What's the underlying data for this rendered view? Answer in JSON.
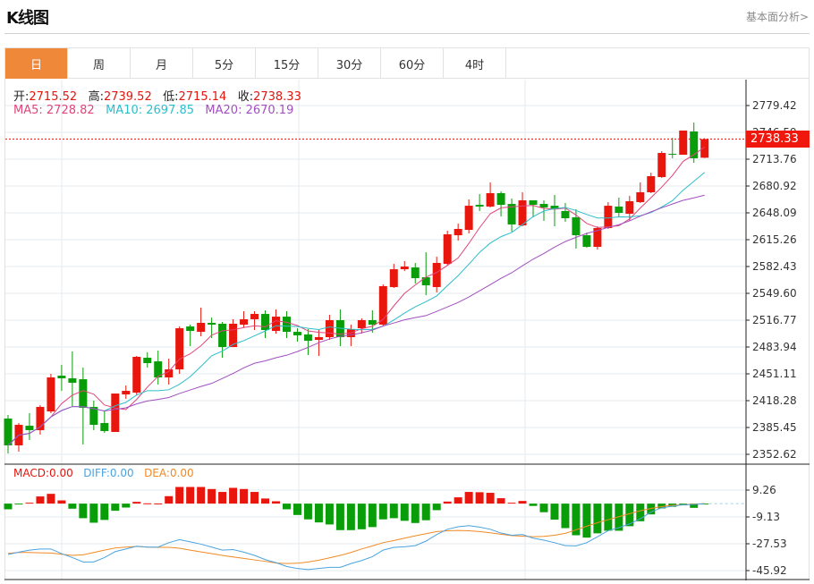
{
  "header": {
    "title": "K线图",
    "link": "基本面分析>"
  },
  "tabs": [
    {
      "label": "日",
      "active": true
    },
    {
      "label": "周"
    },
    {
      "label": "月"
    },
    {
      "label": "5分"
    },
    {
      "label": "15分"
    },
    {
      "label": "30分"
    },
    {
      "label": "60分"
    },
    {
      "label": "4时"
    }
  ],
  "ohlc_info": {
    "open_label": "开:",
    "open": "2715.52",
    "high_label": "高:",
    "high": "2739.52",
    "low_label": "低:",
    "low": "2715.14",
    "close_label": "收:",
    "close": "2738.33"
  },
  "ma_info": {
    "ma5_label": "MA5:",
    "ma5": "2728.82",
    "ma10_label": "MA10:",
    "ma10": "2697.85",
    "ma20_label": "MA20:",
    "ma20": "2670.19"
  },
  "macd_info": {
    "macd_label": "MACD:",
    "macd": "0.00",
    "diff_label": "DIFF:",
    "diff": "0.00",
    "dea_label": "DEA:",
    "dea": "0.00"
  },
  "last_price_tag": "2738.33",
  "colors": {
    "up": "#e8160c",
    "down": "#0a9d0a",
    "accent_tab": "#f0883a",
    "ma5": "#e0457b",
    "ma10": "#2dbdcb",
    "ma20": "#a24fbf",
    "diff": "#4aa3e0",
    "dea": "#f08a24"
  },
  "chart_data": [
    {
      "type": "candlestick",
      "title": "",
      "y_ticks": [
        "2779.42",
        "2746.59",
        "2713.76",
        "2680.92",
        "2648.09",
        "2615.26",
        "2582.43",
        "2549.60",
        "2516.77",
        "2483.94",
        "2451.11",
        "2418.28",
        "2385.45",
        "2352.62"
      ],
      "ylim": [
        2352.62,
        2779.42
      ],
      "grid": true,
      "last_price": 2738.33,
      "moving_averages": [
        5,
        10,
        20
      ],
      "candles": [
        [
          2396.4,
          2400.8,
          2353.7,
          2363.6
        ],
        [
          2363.6,
          2390.9,
          2355.9,
          2388.7
        ],
        [
          2387.6,
          2403.0,
          2370.1,
          2382.2
        ],
        [
          2382.2,
          2412.8,
          2376.7,
          2410.6
        ],
        [
          2405.1,
          2451.1,
          2403.0,
          2446.7
        ],
        [
          2448.9,
          2462.0,
          2430.3,
          2445.6
        ],
        [
          2445.6,
          2478.5,
          2410.6,
          2440.2
        ],
        [
          2444.5,
          2458.8,
          2364.6,
          2409.5
        ],
        [
          2410.6,
          2418.3,
          2382.2,
          2388.7
        ],
        [
          2390.9,
          2406.2,
          2378.9,
          2381.1
        ],
        [
          2380.0,
          2427.0,
          2380.0,
          2427.0
        ],
        [
          2425.9,
          2436.9,
          2420.5,
          2430.3
        ],
        [
          2428.1,
          2473.0,
          2424.8,
          2471.9
        ],
        [
          2470.8,
          2477.4,
          2458.8,
          2464.2
        ],
        [
          2466.4,
          2479.6,
          2438.0,
          2446.7
        ],
        [
          2446.7,
          2469.7,
          2438.0,
          2456.6
        ],
        [
          2456.6,
          2509.1,
          2451.1,
          2506.9
        ],
        [
          2509.1,
          2511.3,
          2485.0,
          2503.6
        ],
        [
          2502.5,
          2532.1,
          2497.1,
          2513.5
        ],
        [
          2513.5,
          2520.0,
          2494.9,
          2511.3
        ],
        [
          2512.4,
          2514.6,
          2470.8,
          2483.9
        ],
        [
          2483.9,
          2517.9,
          2483.9,
          2512.4
        ],
        [
          2511.3,
          2527.7,
          2508.0,
          2517.9
        ],
        [
          2517.9,
          2527.7,
          2504.7,
          2524.4
        ],
        [
          2524.4,
          2528.8,
          2494.9,
          2504.7
        ],
        [
          2503.6,
          2529.9,
          2500.4,
          2521.1
        ],
        [
          2521.1,
          2527.7,
          2494.9,
          2502.5
        ],
        [
          2502.5,
          2506.9,
          2490.5,
          2498.2
        ],
        [
          2499.3,
          2505.8,
          2474.1,
          2491.6
        ],
        [
          2492.7,
          2504.7,
          2473.0,
          2496.0
        ],
        [
          2496.0,
          2523.3,
          2492.7,
          2516.8
        ],
        [
          2516.8,
          2529.9,
          2485.0,
          2496.0
        ],
        [
          2496.0,
          2511.3,
          2485.0,
          2505.8
        ],
        [
          2506.9,
          2519.0,
          2500.4,
          2516.8
        ],
        [
          2516.8,
          2528.8,
          2501.4,
          2511.3
        ],
        [
          2511.3,
          2560.5,
          2509.1,
          2558.4
        ],
        [
          2557.3,
          2585.7,
          2556.2,
          2579.1
        ],
        [
          2579.1,
          2589.0,
          2577.0,
          2582.4
        ],
        [
          2581.3,
          2586.8,
          2561.6,
          2568.2
        ],
        [
          2569.3,
          2599.9,
          2547.4,
          2559.4
        ],
        [
          2557.3,
          2594.5,
          2550.7,
          2586.8
        ],
        [
          2585.7,
          2626.2,
          2583.5,
          2621.8
        ],
        [
          2620.7,
          2635.0,
          2614.2,
          2628.4
        ],
        [
          2627.3,
          2664.5,
          2622.9,
          2656.8
        ],
        [
          2657.9,
          2671.1,
          2650.3,
          2655.8
        ],
        [
          2655.8,
          2685.3,
          2654.7,
          2672.2
        ],
        [
          2672.2,
          2674.4,
          2643.7,
          2657.9
        ],
        [
          2659.0,
          2665.6,
          2625.1,
          2633.9
        ],
        [
          2632.8,
          2673.3,
          2631.7,
          2663.4
        ],
        [
          2663.4,
          2663.4,
          2642.6,
          2657.9
        ],
        [
          2659.0,
          2663.4,
          2638.2,
          2654.7
        ],
        [
          2656.8,
          2670.0,
          2631.7,
          2652.5
        ],
        [
          2650.3,
          2660.1,
          2637.2,
          2641.5
        ],
        [
          2642.6,
          2652.5,
          2604.3,
          2620.7
        ],
        [
          2620.7,
          2624.0,
          2605.4,
          2606.5
        ],
        [
          2606.5,
          2631.7,
          2603.2,
          2629.5
        ],
        [
          2629.5,
          2661.2,
          2628.4,
          2656.8
        ],
        [
          2655.8,
          2666.7,
          2643.7,
          2648.1
        ],
        [
          2647.0,
          2668.9,
          2638.2,
          2662.3
        ],
        [
          2661.2,
          2685.3,
          2660.1,
          2673.3
        ],
        [
          2673.3,
          2697.3,
          2672.2,
          2693.0
        ],
        [
          2691.9,
          2723.6,
          2690.8,
          2721.4
        ],
        [
          2720.3,
          2740.0,
          2714.9,
          2719.2
        ],
        [
          2719.2,
          2748.8,
          2719.2,
          2748.8
        ],
        [
          2747.7,
          2758.6,
          2709.4,
          2714.9
        ],
        [
          2715.52,
          2739.52,
          2715.14,
          2738.33
        ]
      ]
    },
    {
      "type": "bar+line",
      "title": "",
      "y_ticks": [
        "9.26",
        "-9.13",
        "-27.53",
        "-45.92"
      ],
      "ylim": [
        -52,
        18
      ],
      "grid": true,
      "histogram": [
        -3.9,
        -0.6,
        0.6,
        4.9,
        6.7,
        2.2,
        -3.5,
        -10.0,
        -13.1,
        -11.2,
        -4.9,
        -2.7,
        1.2,
        0.2,
        0.1,
        5.1,
        11.4,
        11.4,
        11.4,
        10.0,
        8.0,
        10.8,
        10.0,
        8.0,
        3.5,
        1.6,
        -3.9,
        -7.8,
        -10.8,
        -12.9,
        -14.3,
        -18.2,
        -18.2,
        -17.6,
        -16.1,
        -10.8,
        -10.0,
        -11.8,
        -13.3,
        -11.4,
        -4.5,
        1.4,
        4.3,
        8.0,
        7.8,
        7.4,
        3.7,
        0.6,
        1.8,
        -1.6,
        -5.9,
        -11.0,
        -16.8,
        -21.7,
        -23.3,
        -20.4,
        -18.6,
        -18.6,
        -15.5,
        -12.1,
        -7.4,
        -3.3,
        -2.2,
        -1.2,
        -2.9,
        -0.4
      ],
      "diff": [
        -34.9,
        -33.3,
        -31.9,
        -31.1,
        -31.1,
        -34.3,
        -37.0,
        -40.0,
        -40.0,
        -37.0,
        -32.9,
        -31.1,
        -29.2,
        -29.8,
        -29.8,
        -26.8,
        -24.7,
        -26.2,
        -27.8,
        -29.8,
        -31.9,
        -31.5,
        -33.3,
        -35.5,
        -38.4,
        -40.5,
        -43.1,
        -44.5,
        -45.2,
        -44.5,
        -43.7,
        -43.7,
        -41.1,
        -39.0,
        -36.4,
        -31.9,
        -30.0,
        -29.6,
        -28.8,
        -25.7,
        -21.2,
        -17.6,
        -15.9,
        -15.1,
        -16.1,
        -17.6,
        -20.2,
        -21.7,
        -21.2,
        -23.7,
        -25.1,
        -26.8,
        -28.8,
        -29.0,
        -26.8,
        -22.7,
        -18.6,
        -16.5,
        -13.9,
        -10.4,
        -5.7,
        -2.9,
        -1.8,
        -0.8,
        -0.6,
        0.0
      ],
      "dea": [
        -34.1,
        -33.5,
        -33.5,
        -33.7,
        -33.9,
        -34.7,
        -35.5,
        -35.1,
        -33.5,
        -31.9,
        -30.4,
        -29.8,
        -29.4,
        -29.8,
        -30.0,
        -30.0,
        -30.6,
        -31.9,
        -33.1,
        -34.3,
        -35.5,
        -36.6,
        -37.6,
        -38.6,
        -39.6,
        -40.7,
        -41.1,
        -40.9,
        -40.0,
        -38.8,
        -37.2,
        -35.5,
        -33.5,
        -31.1,
        -29.0,
        -26.8,
        -25.3,
        -23.7,
        -22.1,
        -20.6,
        -19.2,
        -18.6,
        -18.4,
        -18.6,
        -19.2,
        -20.0,
        -21.0,
        -21.9,
        -22.3,
        -22.7,
        -22.5,
        -21.7,
        -20.4,
        -18.0,
        -15.5,
        -13.1,
        -11.0,
        -9.0,
        -6.9,
        -4.9,
        -3.3,
        -2.0,
        -1.2,
        -0.8,
        -0.4,
        0.0
      ]
    }
  ]
}
